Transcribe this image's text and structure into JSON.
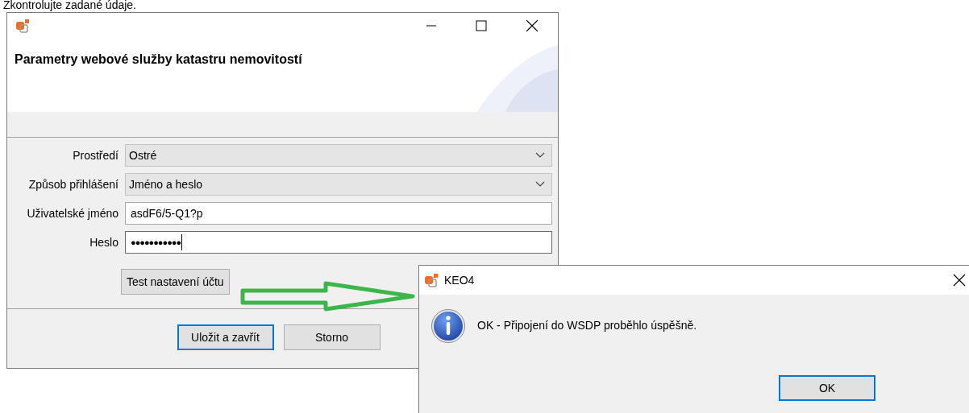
{
  "caption": "Zkontrolujte zadané údaje.",
  "main_window": {
    "title": "Parametry webové služby katastru nemovitostí",
    "fields": [
      {
        "kind": "dropdown",
        "label": "Prostředí",
        "value": "Ostré"
      },
      {
        "kind": "dropdown",
        "label": "Způsob přihlášení",
        "value": "Jméno a heslo"
      },
      {
        "kind": "text",
        "label": "Uživatelské jméno",
        "value": "asdF6/5-Q1?p",
        "focused": false
      },
      {
        "kind": "password",
        "label": "Heslo",
        "value": "●●●●●●●●●●●",
        "focused": true
      }
    ],
    "test_button": "Test nastavení účtu",
    "buttons": [
      {
        "label": "Uložit a zavřít",
        "default": true
      },
      {
        "label": "Storno",
        "default": false
      }
    ]
  },
  "dialog": {
    "title": "KEO4",
    "message": "OK - Připojení do WSDP proběhlo úspěšně.",
    "buttons": [
      {
        "label": "OK",
        "default": true
      }
    ]
  }
}
